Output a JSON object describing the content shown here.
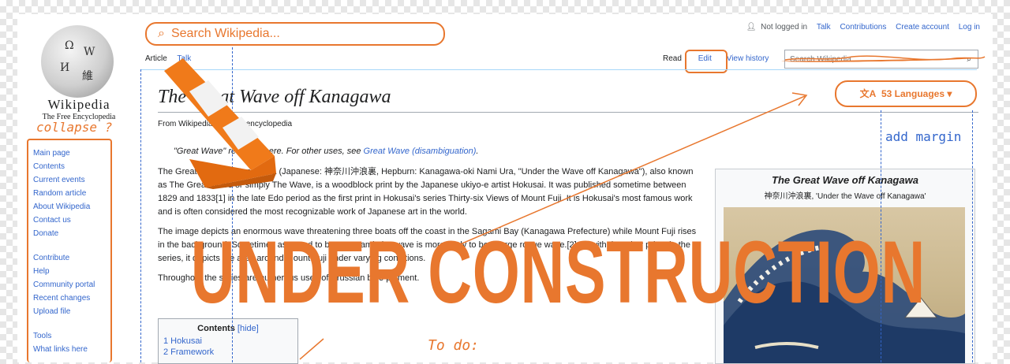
{
  "logo": {
    "wordmark": "Wikipedia",
    "tagline": "The Free Encyclopedia",
    "glyphs": [
      "Ω",
      "W",
      "И",
      "維"
    ]
  },
  "sidebar": {
    "main_items": [
      "Main page",
      "Contents",
      "Current events",
      "Random article",
      "About Wikipedia",
      "Contact us",
      "Donate"
    ],
    "contribute_heading": "Contribute",
    "contribute_items": [
      "Help",
      "Community portal",
      "Recent changes",
      "Upload file"
    ],
    "tools_heading": "Tools",
    "tools_items": [
      "What links here"
    ]
  },
  "annotations": {
    "collapse_note": "collapse ?",
    "search_pill": "Search Wikipedia...",
    "add_margin": "add margin",
    "todo": "To do:",
    "under_construction": "UNDER CONSTRUCTION"
  },
  "personal": {
    "not_logged_in": "Not logged in",
    "talk": "Talk",
    "contributions": "Contributions",
    "create_account": "Create account",
    "log_in": "Log in"
  },
  "tabs": {
    "article": "Article",
    "talk": "Talk",
    "read": "Read",
    "edit": "Edit",
    "view_history": "View history"
  },
  "search": {
    "placeholder": "Search Wikipedia"
  },
  "languages": {
    "label": "53 Languages"
  },
  "article": {
    "title": "The Great Wave off Kanagawa",
    "from": "From Wikipedia, the free encyclopedia",
    "hatnote_prefix": "\"Great Wave\" redirects here. For other uses, see ",
    "hatnote_link": "Great Wave (disambiguation)",
    "p1": "The Great Wave off Kanagawa (Japanese: 神奈川沖浪裏, Hepburn: Kanagawa-oki Nami Ura, \"Under the Wave off Kanagawa\"), also known as The Great Wave or simply The Wave, is a woodblock print by the Japanese ukiyo-e artist Hokusai. It was published sometime between 1829 and 1833[1] in the late Edo period as the first print in Hokusai's series Thirty-six Views of Mount Fuji. It is Hokusai's most famous work and is often considered the most recognizable work of Japanese art in the world.",
    "p2": "The image depicts an enormous wave threatening three boats off the coast in the Sagami Bay (Kanagawa Prefecture) while Mount Fuji rises in the background. Sometimes assumed to be a tsunami, the wave is more likely to be a large rogue wave.[2] As with the other prints in the series, it depicts the area around Mount Fuji under varying conditions.",
    "p3": "Throughout the series are numerous uses of Prussian blue pigment."
  },
  "toc": {
    "heading": "Contents",
    "hide": "[hide]",
    "items": [
      "1 Hokusai",
      "2 Framework"
    ]
  },
  "infobox": {
    "title": "The Great Wave off Kanagawa",
    "subtitle": "神奈川沖浪裏, 'Under the Wave off Kanagawa'"
  },
  "colors": {
    "accent": "#e8772e",
    "link": "#3366cc",
    "text": "#202122"
  }
}
